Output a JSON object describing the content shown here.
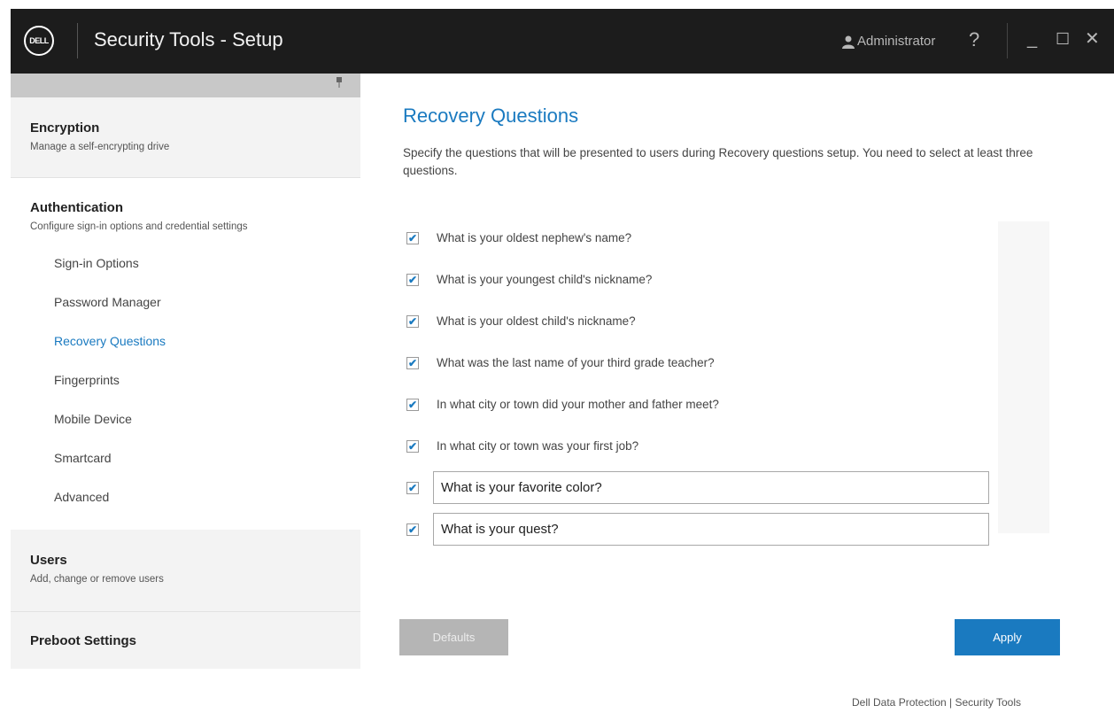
{
  "titlebar": {
    "logo_text": "DELL",
    "title": "Security Tools - Setup",
    "user": "Administrator",
    "help": "?",
    "minimize": "_",
    "maximize": "☐",
    "close": "✕"
  },
  "sidebar": {
    "pin_icon": "pin-icon",
    "encryption": {
      "title": "Encryption",
      "subtitle": "Manage a self-encrypting drive"
    },
    "authentication": {
      "title": "Authentication",
      "subtitle": "Configure sign-in options and credential settings",
      "items": [
        {
          "label": "Sign-in Options"
        },
        {
          "label": "Password Manager"
        },
        {
          "label": "Recovery Questions",
          "active": true
        },
        {
          "label": "Fingerprints"
        },
        {
          "label": "Mobile Device"
        },
        {
          "label": "Smartcard"
        },
        {
          "label": "Advanced"
        }
      ]
    },
    "users": {
      "title": "Users",
      "subtitle": "Add, change or remove users"
    },
    "preboot": {
      "title": "Preboot Settings"
    }
  },
  "main": {
    "title": "Recovery Questions",
    "description": "Specify the questions that will be presented to users during Recovery questions setup. You need to select at least three questions.",
    "questions": [
      {
        "text": "What is your oldest nephew's name?",
        "checked": true
      },
      {
        "text": "What is your youngest child's nickname?",
        "checked": true
      },
      {
        "text": "What is your oldest child's nickname?",
        "checked": true
      },
      {
        "text": "What was the last name of your third grade teacher?",
        "checked": true
      },
      {
        "text": "In what city or town did your mother and father meet?",
        "checked": true
      },
      {
        "text": "In what city or town was your first job?",
        "checked": true
      }
    ],
    "custom_questions": [
      {
        "value": "What is your favorite color?",
        "checked": true
      },
      {
        "value": "What is your quest?",
        "checked": true
      }
    ],
    "checkmark": "✔",
    "defaults_label": "Defaults",
    "apply_label": "Apply"
  },
  "footer": {
    "text": "Dell Data Protection | Security Tools"
  },
  "colors": {
    "accent": "#1a7ac0",
    "titlebar": "#1c1c1c"
  }
}
